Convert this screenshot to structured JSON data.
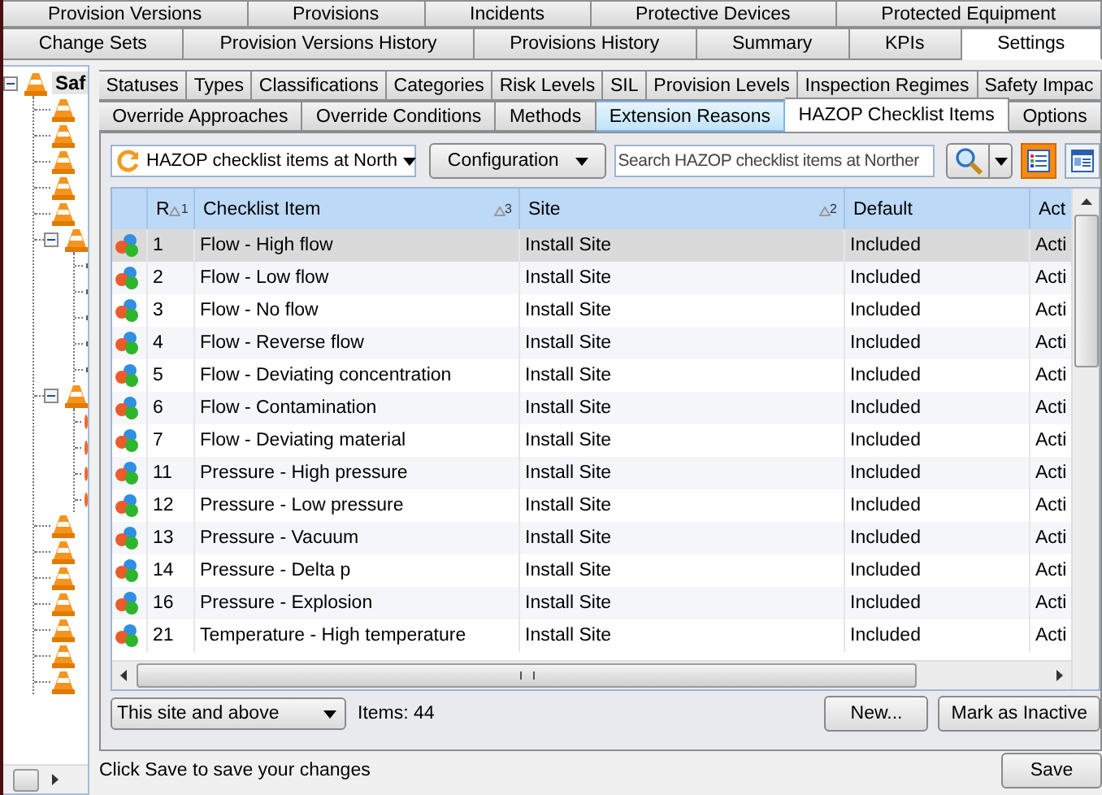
{
  "main_tabs_row1": [
    {
      "label": "Provision Versions",
      "selected": false
    },
    {
      "label": "Provisions",
      "selected": false
    },
    {
      "label": "Incidents",
      "selected": false
    },
    {
      "label": "Protective Devices",
      "selected": false
    },
    {
      "label": "Protected Equipment",
      "selected": false
    }
  ],
  "main_tabs_row2": [
    {
      "label": "Change Sets",
      "selected": false
    },
    {
      "label": "Provision Versions History",
      "selected": false
    },
    {
      "label": "Provisions History",
      "selected": false
    },
    {
      "label": "Summary",
      "selected": false
    },
    {
      "label": "KPIs",
      "selected": false
    },
    {
      "label": "Settings",
      "selected": true
    }
  ],
  "tree": {
    "label": "Saf",
    "expanded": true,
    "children": [
      {
        "kind": "cone"
      },
      {
        "kind": "cone"
      },
      {
        "kind": "cone"
      },
      {
        "kind": "cone"
      },
      {
        "kind": "cone"
      },
      {
        "kind": "cone",
        "expanded": true,
        "children": [
          {
            "kind": "item"
          },
          {
            "kind": "item"
          },
          {
            "kind": "item"
          },
          {
            "kind": "item"
          },
          {
            "kind": "item"
          }
        ]
      },
      {
        "kind": "cone",
        "expanded": true,
        "children": [
          {
            "kind": "flame"
          },
          {
            "kind": "flame"
          },
          {
            "kind": "flame"
          },
          {
            "kind": "flame"
          }
        ]
      },
      {
        "kind": "cone"
      },
      {
        "kind": "cone"
      },
      {
        "kind": "cone"
      },
      {
        "kind": "cone"
      },
      {
        "kind": "cone"
      },
      {
        "kind": "cone"
      },
      {
        "kind": "cone"
      }
    ]
  },
  "settings_tabs_row1": [
    {
      "label": "Statuses",
      "selected": false
    },
    {
      "label": "Types",
      "selected": false
    },
    {
      "label": "Classifications",
      "selected": false
    },
    {
      "label": "Categories",
      "selected": false
    },
    {
      "label": "Risk Levels",
      "selected": false
    },
    {
      "label": "SIL",
      "selected": false
    },
    {
      "label": "Provision Levels",
      "selected": false
    },
    {
      "label": "Inspection Regimes",
      "selected": false
    },
    {
      "label": "Safety Impac",
      "selected": false
    }
  ],
  "settings_tabs_row2": [
    {
      "label": "Override Approaches",
      "selected": false,
      "hovered": false
    },
    {
      "label": "Override Conditions",
      "selected": false,
      "hovered": false
    },
    {
      "label": "Methods",
      "selected": false,
      "hovered": false
    },
    {
      "label": "Extension Reasons",
      "selected": false,
      "hovered": true
    },
    {
      "label": "HAZOP Checklist Items",
      "selected": true,
      "hovered": false
    },
    {
      "label": "Options",
      "selected": false,
      "hovered": false
    }
  ],
  "toolbar": {
    "view_dropdown": "HAZOP checklist items at North",
    "configuration_button": "Configuration",
    "search": {
      "placeholder": "Search HAZOP checklist items at Norther"
    },
    "list_view_selected": true,
    "detail_view_selected": false
  },
  "table": {
    "columns": [
      {
        "label": "R",
        "sort_index": "1"
      },
      {
        "label": "Checklist Item",
        "sort_index": "3"
      },
      {
        "label": "Site",
        "sort_index": "2"
      },
      {
        "label": "Default"
      },
      {
        "label": "Act"
      }
    ],
    "rows": [
      {
        "selected": true,
        "cells": [
          "1",
          "Flow - High flow",
          "Install Site",
          "Included",
          "Acti"
        ]
      },
      {
        "selected": false,
        "cells": [
          "2",
          "Flow - Low flow",
          "Install Site",
          "Included",
          "Acti"
        ]
      },
      {
        "selected": false,
        "cells": [
          "3",
          "Flow - No flow",
          "Install Site",
          "Included",
          "Acti"
        ]
      },
      {
        "selected": false,
        "cells": [
          "4",
          "Flow - Reverse flow",
          "Install Site",
          "Included",
          "Acti"
        ]
      },
      {
        "selected": false,
        "cells": [
          "5",
          "Flow - Deviating concentration",
          "Install Site",
          "Included",
          "Acti"
        ]
      },
      {
        "selected": false,
        "cells": [
          "6",
          "Flow - Contamination",
          "Install Site",
          "Included",
          "Acti"
        ]
      },
      {
        "selected": false,
        "cells": [
          "7",
          "Flow - Deviating material",
          "Install Site",
          "Included",
          "Acti"
        ]
      },
      {
        "selected": false,
        "cells": [
          "11",
          "Pressure - High pressure",
          "Install Site",
          "Included",
          "Acti"
        ]
      },
      {
        "selected": false,
        "cells": [
          "12",
          "Pressure - Low pressure",
          "Install Site",
          "Included",
          "Acti"
        ]
      },
      {
        "selected": false,
        "cells": [
          "13",
          "Pressure - Vacuum",
          "Install Site",
          "Included",
          "Acti"
        ]
      },
      {
        "selected": false,
        "cells": [
          "14",
          "Pressure - Delta p",
          "Install Site",
          "Included",
          "Acti"
        ]
      },
      {
        "selected": false,
        "cells": [
          "16",
          "Pressure - Explosion",
          "Install Site",
          "Included",
          "Acti"
        ]
      },
      {
        "selected": false,
        "cells": [
          "21",
          "Temperature - High temperature",
          "Install Site",
          "Included",
          "Acti"
        ]
      }
    ]
  },
  "footer": {
    "scope_dropdown": "This site and above",
    "item_count": "Items: 44",
    "new_button": "New...",
    "inactive_button": "Mark as Inactive"
  },
  "status_bar": {
    "message": "Click Save to save your changes",
    "save_button": "Save"
  }
}
